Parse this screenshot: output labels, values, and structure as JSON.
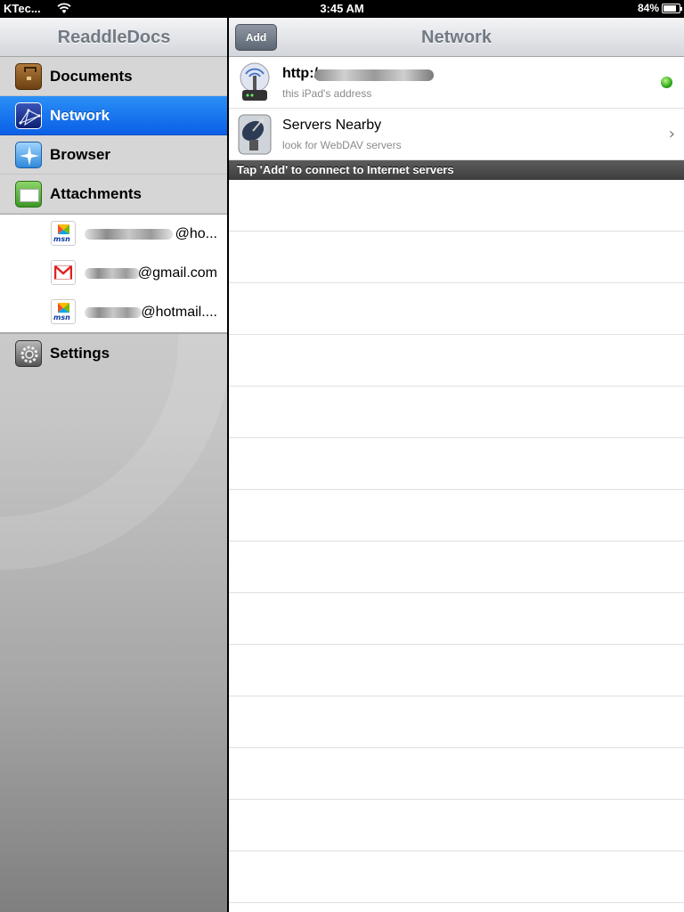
{
  "status_bar": {
    "carrier": "KTec...",
    "time": "3:45 AM",
    "battery_text": "84%",
    "battery_level": 0.84
  },
  "sidebar": {
    "title": "ReaddleDocs",
    "items": [
      {
        "label": "Documents",
        "icon": "briefcase-icon"
      },
      {
        "label": "Network",
        "icon": "network-icon",
        "selected": true
      },
      {
        "label": "Browser",
        "icon": "compass-icon"
      },
      {
        "label": "Attachments",
        "icon": "envelope-icon"
      }
    ],
    "accounts": [
      {
        "address_suffix": "@ho...",
        "icon": "msn-icon"
      },
      {
        "address_suffix": "@gmail.com",
        "icon": "gmail-icon"
      },
      {
        "address_suffix": "@hotmail....",
        "icon": "msn-icon"
      }
    ],
    "settings": {
      "label": "Settings",
      "icon": "gear-icon"
    },
    "msn_label": "msn"
  },
  "main": {
    "title": "Network",
    "add_button": "Add",
    "rows": [
      {
        "title": "http:/",
        "subtitle": "this iPad's address",
        "icon": "wifi-router-icon",
        "status": "online",
        "status_color": "#2fa81a"
      },
      {
        "title": "Servers Nearby",
        "subtitle": "look for WebDAV servers",
        "icon": "satellite-dish-icon",
        "accessory": "›"
      }
    ],
    "section_header": "Tap 'Add' to connect to Internet servers"
  },
  "colors": {
    "selection_blue": "#0a5fe6",
    "nav_title_gray": "#727a84"
  }
}
